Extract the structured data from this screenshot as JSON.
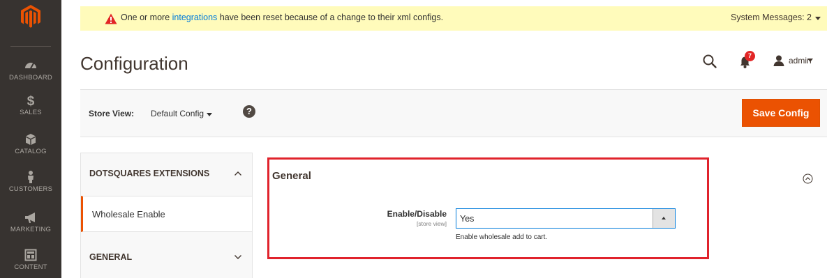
{
  "sidebar": {
    "items": [
      {
        "label": "DASHBOARD",
        "icon": "dashboard-icon"
      },
      {
        "label": "SALES",
        "icon": "dollar-icon"
      },
      {
        "label": "CATALOG",
        "icon": "cube-icon"
      },
      {
        "label": "CUSTOMERS",
        "icon": "person-icon"
      },
      {
        "label": "MARKETING",
        "icon": "megaphone-icon"
      },
      {
        "label": "CONTENT",
        "icon": "layout-icon"
      }
    ]
  },
  "system_message": {
    "before": "One or more ",
    "link": "integrations",
    "after": " have been reset because of a change to their xml configs.",
    "counter_label": "System Messages: 2"
  },
  "header": {
    "title": "Configuration",
    "notification_count": "7",
    "user": "admin"
  },
  "store_bar": {
    "label": "Store View:",
    "value": "Default Config",
    "help": "?",
    "save_label": "Save Config"
  },
  "tabs": {
    "groups": [
      {
        "label": "DOTSQUARES EXTENSIONS",
        "state": "expanded",
        "items": [
          "Wholesale Enable"
        ]
      },
      {
        "label": "GENERAL",
        "state": "collapsed"
      }
    ]
  },
  "section": {
    "title": "General",
    "field": {
      "label": "Enable/Disable",
      "scope": "[store view]",
      "value": "Yes",
      "note": "Enable wholesale add to cart."
    }
  },
  "colors": {
    "sidebar_bg": "#373330",
    "accent": "#eb5202",
    "message_bg": "#fffbbb",
    "highlight": "#e0232c",
    "link": "#007bdb"
  }
}
